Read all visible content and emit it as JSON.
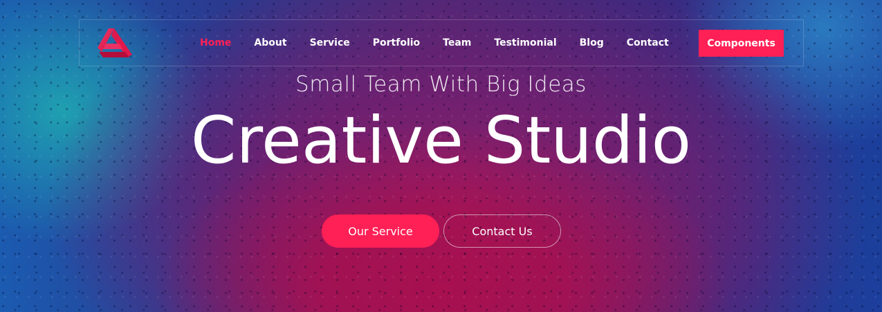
{
  "nav": {
    "links": [
      "Home",
      "About",
      "Service",
      "Portfolio",
      "Team",
      "Testimonial",
      "Blog",
      "Contact"
    ],
    "active": "Home",
    "cta_label": "Components"
  },
  "hero": {
    "subtitle": "Small Team With Big Ideas",
    "title": "Creative Studio",
    "primary_button": "Our Service",
    "secondary_button": "Contact Us"
  },
  "colors": {
    "accent": "#ff2056",
    "text": "#ffffff"
  },
  "icons": {
    "logo": "triangle-logo-icon"
  }
}
